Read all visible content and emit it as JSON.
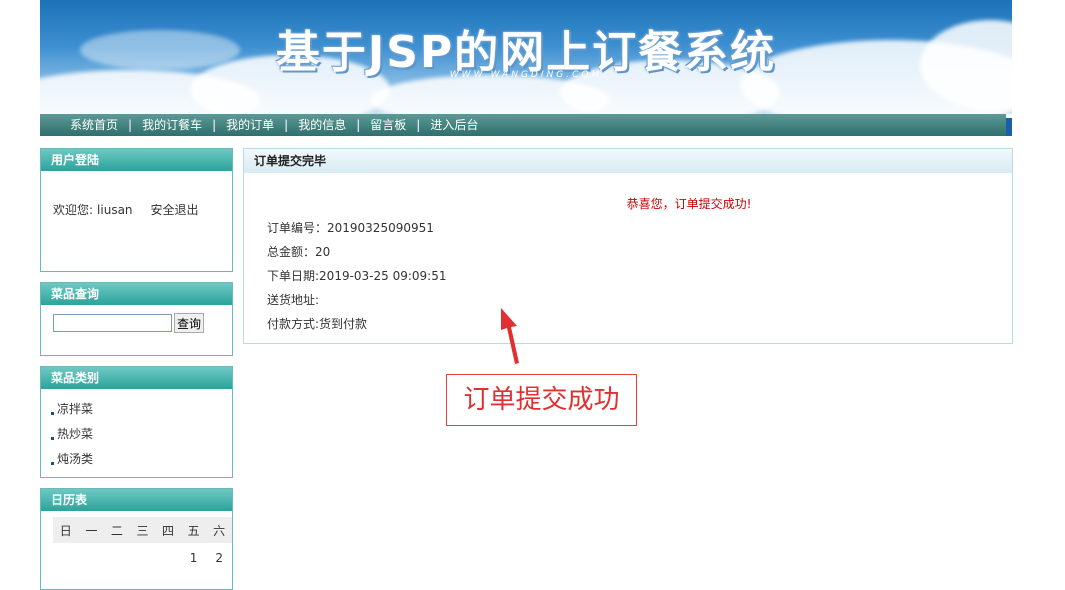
{
  "banner": {
    "title": "基于JSP的网上订餐系统",
    "subtitle": "WWW.WANGDING.COM"
  },
  "nav": {
    "items": [
      "系统首页",
      "我的订餐车",
      "我的订单",
      "我的信息",
      "留言板",
      "进入后台"
    ],
    "separator": "|"
  },
  "login": {
    "title": "用户登陆",
    "welcome_label": "欢迎您:",
    "username": "liusan",
    "logout_label": "安全退出"
  },
  "search": {
    "title": "菜品查询",
    "input_value": "",
    "button_label": "查询"
  },
  "category": {
    "title": "菜品类别",
    "items": [
      "凉拌菜",
      "热炒菜",
      "炖汤类"
    ]
  },
  "calendar": {
    "title": "日历表",
    "weekdays": [
      "日",
      "一",
      "二",
      "三",
      "四",
      "五",
      "六"
    ],
    "first_row": [
      "",
      "",
      "",
      "",
      "",
      "1",
      "2"
    ]
  },
  "order": {
    "title": "订单提交完毕",
    "success_message": "恭喜您，订单提交成功!",
    "number_line": "订单编号：20190325090951",
    "total_line": "总金额：20",
    "date_line": "下单日期:2019-03-25 09:09:51",
    "address_line": "送货地址:",
    "payment_line": "付款方式:货到付款"
  },
  "annotation": {
    "text": "订单提交成功",
    "color": "#e03030"
  },
  "colors": {
    "nav_bg": "#2f6f6c",
    "panel_head": "#2aa39b",
    "success": "#cc0000"
  }
}
